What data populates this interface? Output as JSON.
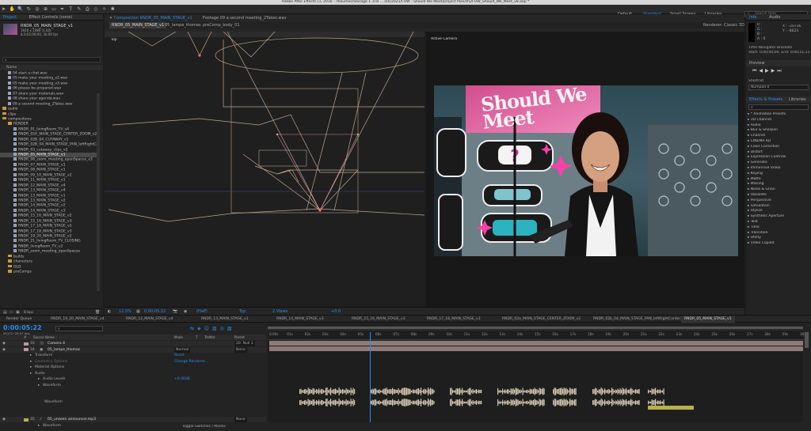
{
  "window": {
    "title": "Adobe After Effects CC 2016 - /Volumes/Storage 1 3TB ... ork/2021/FOW - Should We Meet/project files/sfu/FOW_Should_We_Meet_v8.aep *"
  },
  "workspaces": [
    {
      "label": "Default"
    },
    {
      "label": "Standard",
      "active": true
    },
    {
      "label": "Small Screen"
    },
    {
      "label": "Libraries"
    }
  ],
  "search_help": {
    "placeholder": "Search Help"
  },
  "project_panel": {
    "tabs": [
      "Project",
      "Effect Controls (none)"
    ],
    "selected_item": {
      "name": "RNDR_05_MAIN_STAGE_v1",
      "line1": "1920 x 1080 (1.00)",
      "line2": "Δ 0;02;00;00, 30.00 fps"
    },
    "search_placeholder": "",
    "column_name": "Name",
    "items": [
      {
        "label": "04 start a chat.wav",
        "type": "file",
        "indent": 1
      },
      {
        "label": "05 make your meeting_v2.wav",
        "type": "file",
        "indent": 1
      },
      {
        "label": "05 make your meeting_v3.wav",
        "type": "file",
        "indent": 1
      },
      {
        "label": "06 please be prepared.wav",
        "type": "file",
        "indent": 1
      },
      {
        "label": "07 share your materials.wav",
        "type": "file",
        "indent": 1
      },
      {
        "label": "08 share your agenda.wav",
        "type": "file",
        "indent": 1
      },
      {
        "label": "09 a second meeting_2Takes.wav",
        "type": "file",
        "indent": 1
      },
      {
        "label": "audio",
        "type": "folder",
        "indent": 0
      },
      {
        "label": "clips",
        "type": "folder",
        "indent": 0
      },
      {
        "label": "compositions",
        "type": "folder",
        "indent": 0
      },
      {
        "label": "RENDER",
        "type": "folder",
        "indent": 1
      },
      {
        "label": "RNDR_01_livingRoom_TV_v4",
        "type": "comp",
        "indent": 2
      },
      {
        "label": "RNDR_02A_MAIN_STAGE_CENTER_ZOOM_v2",
        "type": "comp",
        "indent": 2
      },
      {
        "label": "RNDR_02B_04_CUTAWAY_v1",
        "type": "comp",
        "indent": 2
      },
      {
        "label": "RNDR_02B_04_MAIN_STAGE_PAN_leftRightCe",
        "type": "comp",
        "indent": 2
      },
      {
        "label": "RNDR_03_cutaway_clips_v2",
        "type": "comp",
        "indent": 2
      },
      {
        "label": "RNDR_05_MAIN_STAGE_v1",
        "type": "comp",
        "indent": 2,
        "selected": true
      },
      {
        "label": "RNDR_06_zoom_meeting_openSpaces_v3",
        "type": "comp",
        "indent": 2
      },
      {
        "label": "RNDR_07_MAIN_STAGE_v1",
        "type": "comp",
        "indent": 2
      },
      {
        "label": "RNDR_08_MAIN_STAGE_v1",
        "type": "comp",
        "indent": 2
      },
      {
        "label": "RNDR_09_10_MAIN_STAGE_v2",
        "type": "comp",
        "indent": 2
      },
      {
        "label": "RNDR_11_MAIN_STAGE_v1",
        "type": "comp",
        "indent": 2
      },
      {
        "label": "RNDR_12_MAIN_STAGE_v4",
        "type": "comp",
        "indent": 2
      },
      {
        "label": "RNDR_13_MAIN_STAGE_v4",
        "type": "comp",
        "indent": 2
      },
      {
        "label": "RNDR_13_MAIN_STAGE_v1",
        "type": "comp",
        "indent": 2
      },
      {
        "label": "RNDR_13_MAIN_STAGE_v2",
        "type": "comp",
        "indent": 2
      },
      {
        "label": "RNDR_14_MAIN_STAGE_v2",
        "type": "comp",
        "indent": 2
      },
      {
        "label": "RNDR_14_MAIN_STAGE_v3",
        "type": "comp",
        "indent": 2
      },
      {
        "label": "RNDR_15_16_MAIN_STAGE_v2",
        "type": "comp",
        "indent": 2
      },
      {
        "label": "RNDR_15_16_MAIN_STAGE_v3",
        "type": "comp",
        "indent": 2
      },
      {
        "label": "RNDR_17_18_MAIN_STAGE_v2",
        "type": "comp",
        "indent": 2
      },
      {
        "label": "RNDR_17_18_MAIN_STAGE_v3",
        "type": "comp",
        "indent": 2
      },
      {
        "label": "RNDR_19_20_MAIN_STAGE_v2",
        "type": "comp",
        "indent": 2
      },
      {
        "label": "RNDR_21_livingRoom_TV_CLOSING",
        "type": "comp",
        "indent": 2
      },
      {
        "label": "RNDR_livingRoom_TV_v3",
        "type": "comp",
        "indent": 2
      },
      {
        "label": "RNDR_zoom_meeting_openSpaces",
        "type": "comp",
        "indent": 2
      },
      {
        "label": "builds",
        "type": "folder",
        "indent": 1
      },
      {
        "label": "characters",
        "type": "folder",
        "indent": 1
      },
      {
        "label": "OLD",
        "type": "folder",
        "indent": 1
      },
      {
        "label": "preComps",
        "type": "folder",
        "indent": 1
      }
    ],
    "bpc": "8 bpc"
  },
  "viewer_tabs": {
    "composition": "Composition RNDR_05_MAIN_STAGE_v1",
    "footage": "Footage 09 a second meeting_2Takes.wav",
    "breadcrumbs": [
      "RNDR_05_MAIN_STAGE_v1",
      "05_lampe_thomas",
      "preComp_body_01"
    ],
    "renderer": "Renderer: Classic 3D"
  },
  "left_view": {
    "label": "Top"
  },
  "right_view": {
    "label": "Active Camera",
    "scene_text": "Should We Meet"
  },
  "viewer_footer": {
    "zoom": "12.5%",
    "timecode": "0;00;05;22",
    "quality": "(Half)",
    "view": "Top",
    "views": "2 Views",
    "offset": "+0.0"
  },
  "info_panel": {
    "tabs": [
      "Info",
      "Audio"
    ],
    "rgba": [
      "R :",
      "G :",
      "B :",
      "A : 0"
    ],
    "xy": [
      "X : -20736",
      "Y : -8624"
    ],
    "nav_title": "Time Navigator Brackets",
    "nav_range": "Start: 0;00;00;00, End: 0;00;51;13"
  },
  "preview_panel": {
    "title": "Preview",
    "shortcut_label": "Shortcut",
    "shortcut_value": "Numpad 0"
  },
  "effects_panel": {
    "tabs": [
      "Effects & Presets",
      "Libraries"
    ],
    "items": [
      "* Animation Presets",
      "3D Channel",
      "Audio",
      "Blur & Sharpen",
      "Channel",
      "CINEMA 4D",
      "Color Correction",
      "Distort",
      "Expression Controls",
      "Generate",
      "Immersive Video",
      "Keying",
      "Matte",
      "Missing",
      "Noise & Grain",
      "Obsolete",
      "Perspective",
      "Simulation",
      "Stylize",
      "Synthetic Aperture",
      "Text",
      "Time",
      "Transition",
      "Utility",
      "Video Copilot"
    ]
  },
  "timeline": {
    "tabs": [
      "Render Queue",
      "RNDR_19_20_MAIN_STAGE_v4",
      "RNDR_12_MAIN_STAGE_v4",
      "RNDR_13_MAIN_STAGE_v1",
      "RNDR_14_MAIN_STAGE_v3",
      "RNDR_15_16_MAIN_STAGE_v3",
      "RNDR_17_18_MAIN_STAGE_v3",
      "RNDR_02a_MAIN_STAGE_CENTER_ZOOM_v2",
      "RNDR_02b_04_MAIN_STAGE_PAN_leftRightCenter_v7",
      "RNDR_05_MAIN_STAGE_v1"
    ],
    "active_tab_index": 9,
    "timecode": "0:00:05:22",
    "frame_info": "00172 (29.97 fps)",
    "search_placeholder": "",
    "columns": [
      "#",
      "Source Name",
      "Mode",
      "T",
      "TrkMat",
      "Parent"
    ],
    "ruler": [
      "0:00s",
      "01s",
      "02s",
      "03s",
      "04s",
      "05s",
      "06s",
      "07s",
      "08s",
      "09s",
      "10s",
      "11s",
      "12s",
      "13s",
      "14s",
      "15s",
      "16s",
      "17s",
      "18s",
      "19s",
      "20s",
      "21s",
      "22s",
      "23s",
      "24s",
      "25s",
      "26s",
      "27s",
      "28s",
      "29s",
      "30s"
    ],
    "playhead_fraction": 0.19,
    "layers": [
      {
        "num": "33",
        "name": "Camera 4",
        "mode": "",
        "parent": "20. Null 1",
        "kind": "camera"
      },
      {
        "num": "34",
        "name": "05_lampe_thomas",
        "mode": "Normal",
        "parent": "None",
        "kind": "layer"
      },
      {
        "num": "",
        "name": "Transform",
        "kind": "prop",
        "value": "Reset"
      },
      {
        "num": "",
        "name": "Geometry Options",
        "kind": "prop-dim",
        "value": "Change Renderer..."
      },
      {
        "num": "",
        "name": "Material Options",
        "kind": "prop"
      },
      {
        "num": "",
        "name": "Audio",
        "kind": "prop"
      },
      {
        "num": "",
        "name": "Audio Levels",
        "kind": "prop2",
        "value": "+0.00dB"
      },
      {
        "num": "",
        "name": "Waveform",
        "kind": "prop2"
      },
      {
        "num": "",
        "name": "Waveform",
        "kind": "wave"
      },
      {
        "num": "35",
        "name": "05_unseen announcer.mp3",
        "mode": "",
        "parent": "None",
        "kind": "audio"
      },
      {
        "num": "",
        "name": "Waveform",
        "kind": "prop2"
      }
    ],
    "footer": "Toggle Switches / Modes"
  },
  "colors": {
    "accent": "#2d8ceb",
    "layer_bar": "#8c7c79",
    "audio_bar": "#b8b24a",
    "waveform": "#d0c4ad",
    "guide": "#c0a58c"
  }
}
